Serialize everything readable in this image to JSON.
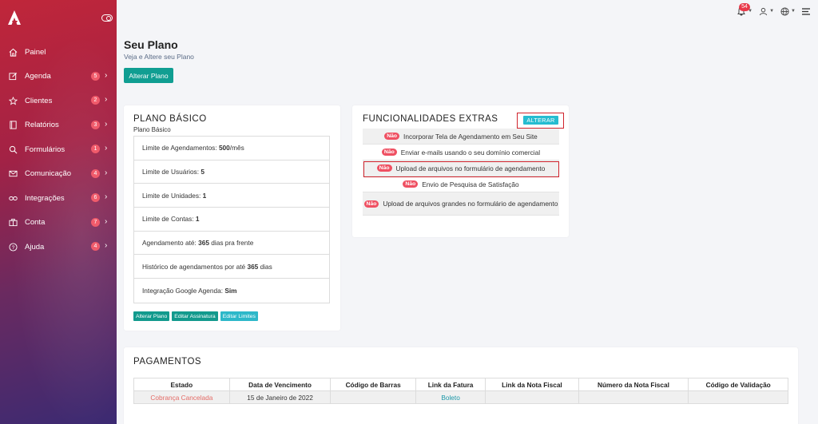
{
  "sidebar": {
    "items": [
      {
        "label": "Painel",
        "icon": "home-icon",
        "badge": "",
        "chevron": false
      },
      {
        "label": "Agenda",
        "icon": "edit-icon",
        "badge": "5",
        "chevron": true
      },
      {
        "label": "Clientes",
        "icon": "star-icon",
        "badge": "2",
        "chevron": true
      },
      {
        "label": "Relatórios",
        "icon": "book-icon",
        "badge": "3",
        "chevron": true
      },
      {
        "label": "Formulários",
        "icon": "search-icon",
        "badge": "1",
        "chevron": true
      },
      {
        "label": "Comunicação",
        "icon": "mail-icon",
        "badge": "4",
        "chevron": true
      },
      {
        "label": "Integrações",
        "icon": "link-icon",
        "badge": "6",
        "chevron": true
      },
      {
        "label": "Conta",
        "icon": "briefcase-icon",
        "badge": "7",
        "chevron": true
      },
      {
        "label": "Ajuda",
        "icon": "help-icon",
        "badge": "4",
        "chevron": true
      }
    ]
  },
  "topbar": {
    "notifications": "54"
  },
  "header": {
    "title": "Seu Plano",
    "subtitle": "Veja e Altere seu Plano",
    "alterar_label": "Alterar Plano"
  },
  "plano": {
    "title": "PLANO BÁSICO",
    "subtitle": "Plano Básico",
    "limits": [
      {
        "prefix": "Limite de Agendamentos: ",
        "value": "500",
        "suffix": "/mês"
      },
      {
        "prefix": "Limite de Usuários: ",
        "value": "5",
        "suffix": ""
      },
      {
        "prefix": "Limite de Unidades: ",
        "value": "1",
        "suffix": ""
      },
      {
        "prefix": "Limite de Contas: ",
        "value": "1",
        "suffix": ""
      },
      {
        "prefix": "Agendamento até: ",
        "value": "365",
        "suffix": " dias pra frente"
      },
      {
        "prefix": "Histórico de agendamentos por até ",
        "value": "365",
        "suffix": " dias"
      },
      {
        "prefix": "Integração Google Agenda: ",
        "value": "Sim",
        "suffix": ""
      }
    ],
    "buttons": {
      "alterar": "Alterar Plano",
      "editar_assinatura": "Editar Assinatura",
      "editar_limites": "Editar Limites"
    }
  },
  "funcionalidades": {
    "title": "FUNCIONALIDADES EXTRAS",
    "alterar_label": "ALTERAR",
    "badge_label": "Não",
    "items": [
      "Incorporar Tela de Agendamento em Seu Site",
      "Enviar e-mails usando o seu domínio comercial",
      "Upload de arquivos no formulário de agendamento",
      "Envio de Pesquisa de Satisfação",
      "Upload de arquivos grandes no formulário de agendamento"
    ]
  },
  "pagamentos": {
    "title": "PAGAMENTOS",
    "columns": [
      "Estado",
      "Data de Vencimento",
      "Código de Barras",
      "Link da Fatura",
      "Link da Nota Fiscal",
      "Número da Nota Fiscal",
      "Código de Validação"
    ],
    "rows": [
      [
        "Cobrança Cancelada",
        "15 de Janeiro de 2022",
        "",
        "Boleto",
        "",
        "",
        ""
      ]
    ]
  },
  "colors": {
    "teal": "#109e92",
    "cyan": "#26bcd0",
    "badge_red": "#ef5062",
    "highlight": "#d0232c"
  }
}
